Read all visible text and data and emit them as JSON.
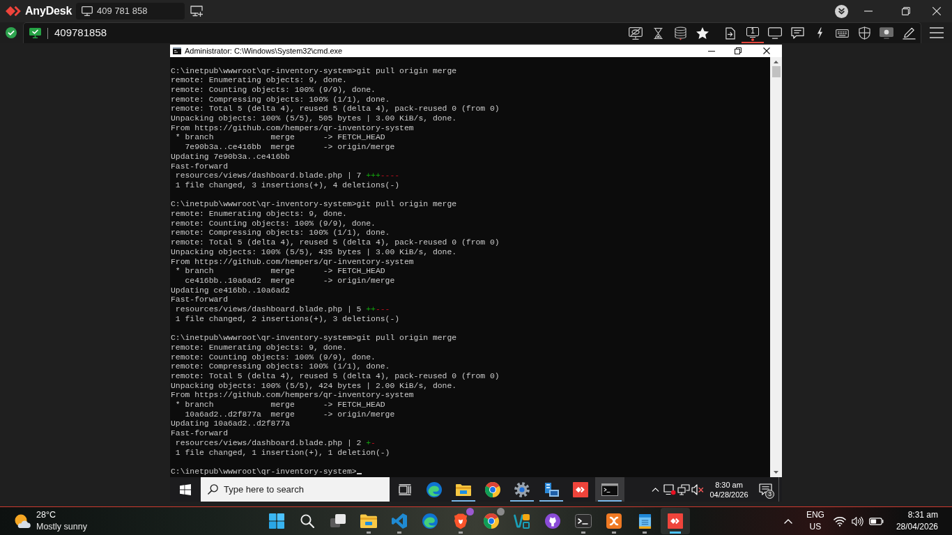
{
  "anydesk": {
    "app_name": "AnyDesk",
    "tabs": [
      {
        "label": "409 781 858",
        "selected": true
      }
    ],
    "address": "409781858",
    "toolbar": [
      {
        "selected": false
      },
      {
        "selected": false
      },
      {
        "selected": false
      },
      {
        "selected": false
      },
      {
        "selected": false
      },
      {
        "label": "1",
        "selected": true
      },
      {
        "selected": false
      },
      {
        "selected": false
      },
      {
        "selected": false
      },
      {
        "selected": false
      },
      {
        "selected": false
      },
      {
        "selected": false
      },
      {
        "selected": false
      }
    ]
  },
  "remote": {
    "cmd_window": {
      "title": "Administrator: C:\\Windows\\System32\\cmd.exe",
      "sessions": [
        {
          "prompt": "C:\\inetpub\\wwwroot\\qr-inventory-system>",
          "command": "git pull origin merge",
          "output": [
            {
              "kind": "text",
              "text": "remote: Enumerating objects: 9, done."
            },
            {
              "kind": "text",
              "text": "remote: Counting objects: 100% (9/9), done."
            },
            {
              "kind": "text",
              "text": "remote: Compressing objects: 100% (1/1), done."
            },
            {
              "kind": "text",
              "text": "remote: Total 5 (delta 4), reused 5 (delta 4), pack-reused 0 (from 0)"
            },
            {
              "kind": "text",
              "text": "Unpacking objects: 100% (5/5), 505 bytes | 3.00 KiB/s, done."
            },
            {
              "kind": "text",
              "text": "From https://github.com/hempers/qr-inventory-system"
            },
            {
              "kind": "text",
              "text": " * branch            merge      -> FETCH_HEAD"
            },
            {
              "kind": "text",
              "text": "   7e90b3a..ce416bb  merge      -> origin/merge"
            },
            {
              "kind": "text",
              "text": "Updating 7e90b3a..ce416bb"
            },
            {
              "kind": "text",
              "text": "Fast-forward"
            },
            {
              "kind": "diffstat",
              "text": " resources/views/dashboard.blade.php | 7 ",
              "insertions": "+++",
              "deletions": "----"
            },
            {
              "kind": "text",
              "text": " 1 file changed, 3 insertions(+), 4 deletions(-)"
            }
          ]
        },
        {
          "prompt": "C:\\inetpub\\wwwroot\\qr-inventory-system>",
          "command": "git pull origin merge",
          "output": [
            {
              "kind": "text",
              "text": "remote: Enumerating objects: 9, done."
            },
            {
              "kind": "text",
              "text": "remote: Counting objects: 100% (9/9), done."
            },
            {
              "kind": "text",
              "text": "remote: Compressing objects: 100% (1/1), done."
            },
            {
              "kind": "text",
              "text": "remote: Total 5 (delta 4), reused 5 (delta 4), pack-reused 0 (from 0)"
            },
            {
              "kind": "text",
              "text": "Unpacking objects: 100% (5/5), 435 bytes | 3.00 KiB/s, done."
            },
            {
              "kind": "text",
              "text": "From https://github.com/hempers/qr-inventory-system"
            },
            {
              "kind": "text",
              "text": " * branch            merge      -> FETCH_HEAD"
            },
            {
              "kind": "text",
              "text": "   ce416bb..10a6ad2  merge      -> origin/merge"
            },
            {
              "kind": "text",
              "text": "Updating ce416bb..10a6ad2"
            },
            {
              "kind": "text",
              "text": "Fast-forward"
            },
            {
              "kind": "diffstat",
              "text": " resources/views/dashboard.blade.php | 5 ",
              "insertions": "++",
              "deletions": "---"
            },
            {
              "kind": "text",
              "text": " 1 file changed, 2 insertions(+), 3 deletions(-)"
            }
          ]
        },
        {
          "prompt": "C:\\inetpub\\wwwroot\\qr-inventory-system>",
          "command": "git pull origin merge",
          "output": [
            {
              "kind": "text",
              "text": "remote: Enumerating objects: 9, done."
            },
            {
              "kind": "text",
              "text": "remote: Counting objects: 100% (9/9), done."
            },
            {
              "kind": "text",
              "text": "remote: Compressing objects: 100% (1/1), done."
            },
            {
              "kind": "text",
              "text": "remote: Total 5 (delta 4), reused 5 (delta 4), pack-reused 0 (from 0)"
            },
            {
              "kind": "text",
              "text": "Unpacking objects: 100% (5/5), 424 bytes | 2.00 KiB/s, done."
            },
            {
              "kind": "text",
              "text": "From https://github.com/hempers/qr-inventory-system"
            },
            {
              "kind": "text",
              "text": " * branch            merge      -> FETCH_HEAD"
            },
            {
              "kind": "text",
              "text": "   10a6ad2..d2f877a  merge      -> origin/merge"
            },
            {
              "kind": "text",
              "text": "Updating 10a6ad2..d2f877a"
            },
            {
              "kind": "text",
              "text": "Fast-forward"
            },
            {
              "kind": "diffstat",
              "text": " resources/views/dashboard.blade.php | 2 ",
              "insertions": "+",
              "deletions": "-"
            },
            {
              "kind": "text",
              "text": " 1 file changed, 1 insertion(+), 1 deletion(-)"
            }
          ]
        }
      ],
      "prompt": "C:\\inetpub\\wwwroot\\qr-inventory-system>"
    },
    "taskbar": {
      "search": {
        "placeholder": "Type here to search"
      },
      "apps": [
        {
          "running": false,
          "active": false
        },
        {
          "running": true,
          "active": false
        },
        {
          "running": false,
          "active": false
        },
        {
          "running": true,
          "active": false
        },
        {
          "running": true,
          "active": false
        },
        {
          "running": false,
          "active": false
        },
        {
          "running": true,
          "active": true
        }
      ],
      "clock": {
        "time": "8:30 am",
        "date": "04/28/2026"
      },
      "notification_count": "3"
    }
  },
  "local_taskbar": {
    "weather": {
      "temperature": "28°C",
      "condition": "Mostly sunny"
    },
    "apps": [
      {
        "running": true,
        "active": false
      },
      {
        "running": true,
        "active": false
      },
      {
        "running": false,
        "active": false
      },
      {
        "running": true,
        "active": false
      },
      {
        "running": false,
        "active": false
      },
      {
        "running": false,
        "active": false
      },
      {
        "running": false,
        "active": false
      },
      {
        "running": true,
        "active": false
      },
      {
        "running": true,
        "active": false
      },
      {
        "running": true,
        "active": false
      },
      {
        "running": true,
        "active": true
      }
    ],
    "language": {
      "line_1": "ENG",
      "line_2": "US"
    },
    "clock": {
      "time": "8:31 am",
      "date": "28/04/2026"
    }
  }
}
